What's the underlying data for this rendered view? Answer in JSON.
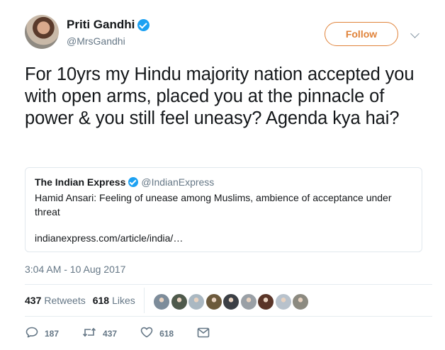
{
  "author": {
    "name": "Priti Gandhi",
    "handle": "@MrsGandhi"
  },
  "follow_label": "Follow",
  "tweet_text": "For 10yrs my Hindu majority nation accepted you with open arms, placed you at the pinnacle of power & you still feel uneasy? Agenda kya hai?",
  "quote": {
    "name": "The Indian Express",
    "handle": "@IndianExpress",
    "text": "Hamid Ansari: Feeling of unease among Muslims, ambience of acceptance under threat",
    "link": "indianexpress.com/article/india/…"
  },
  "timestamp": "3:04 AM - 10 Aug 2017",
  "stats": {
    "retweets_count": "437",
    "retweets_label": "Retweets",
    "likes_count": "618",
    "likes_label": "Likes"
  },
  "liker_avatar_colors": [
    "#7d8c9a",
    "#4f5a4c",
    "#aab8c2",
    "#6c5a3c",
    "#3b3f45",
    "#9aa0a6",
    "#5a3528",
    "#b8c2cc",
    "#8c8a80"
  ],
  "actions": {
    "reply_count": "187",
    "retweet_count": "437",
    "like_count": "618"
  },
  "colors": {
    "accent": "#e0833a",
    "verified": "#1da1f2",
    "secondary_text": "#657786"
  }
}
